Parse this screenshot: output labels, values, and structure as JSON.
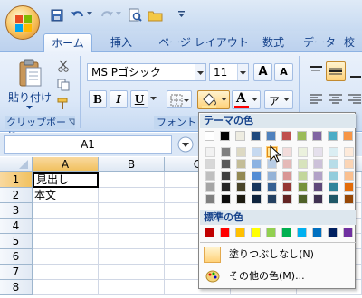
{
  "quick_access": {
    "save_icon": "save-icon",
    "undo_icon": "undo-icon",
    "redo_icon": "redo-icon",
    "print_preview_icon": "print-preview-icon",
    "open_icon": "open-folder-icon",
    "customize_icon": "customize-dropdown-icon"
  },
  "tabs": [
    {
      "label": "ホーム"
    },
    {
      "label": "挿入"
    },
    {
      "label": "ページ レイアウト"
    },
    {
      "label": "数式"
    },
    {
      "label": "データ"
    },
    {
      "label": "校"
    }
  ],
  "ribbon": {
    "clipboard": {
      "paste_label": "貼り付け",
      "group_label": "クリップボード"
    },
    "font": {
      "font_name": "MS Pゴシック",
      "font_size": "11",
      "group_label": "フォント",
      "bold": "B",
      "italic": "I",
      "underline": "U",
      "grow": "A",
      "shrink": "A",
      "font_color_letter": "A",
      "phonetic": "ア"
    }
  },
  "formula_bar": {
    "name_box": "A1"
  },
  "grid": {
    "columns": [
      "A",
      "B",
      "C"
    ],
    "rows": [
      "1",
      "2",
      "3",
      "4",
      "5",
      "6",
      "7",
      "8"
    ],
    "cells": {
      "A1": "見出し",
      "A2": "本文"
    }
  },
  "color_popup": {
    "theme_heading": "テーマの色",
    "standard_heading": "標準の色",
    "no_fill_label": "塗りつぶしなし(N)",
    "more_colors_label": "その他の色(M)...",
    "theme_colors": [
      "#ffffff",
      "#000000",
      "#eeece1",
      "#1f497d",
      "#4f81bd",
      "#c0504d",
      "#9bbb59",
      "#8064a2",
      "#4bacc6",
      "#f79646"
    ],
    "theme_shades": [
      [
        "#f2f2f2",
        "#d8d8d8",
        "#bfbfbf",
        "#a5a5a5",
        "#7f7f7f"
      ],
      [
        "#7f7f7f",
        "#595959",
        "#3f3f3f",
        "#262626",
        "#0c0c0c"
      ],
      [
        "#ddd9c3",
        "#c4bd97",
        "#938953",
        "#494429",
        "#1d1b10"
      ],
      [
        "#c6d9f0",
        "#8db3e2",
        "#548dd4",
        "#17365d",
        "#0f243e"
      ],
      [
        "#dbe5f1",
        "#b8cce4",
        "#95b3d7",
        "#366092",
        "#244061"
      ],
      [
        "#f2dcdb",
        "#e5b9b7",
        "#d99694",
        "#953734",
        "#632423"
      ],
      [
        "#ebf1dd",
        "#d7e3bc",
        "#c3d69b",
        "#76923c",
        "#4f6128"
      ],
      [
        "#e5e0ec",
        "#ccc1d9",
        "#b2a2c7",
        "#5f497a",
        "#3f3151"
      ],
      [
        "#dbeef3",
        "#b7dde8",
        "#92cddc",
        "#31859b",
        "#205867"
      ],
      [
        "#fdeada",
        "#fbd5b5",
        "#fac08f",
        "#e36c09",
        "#974806"
      ]
    ],
    "standard_colors": [
      "#c00000",
      "#ff0000",
      "#ffc000",
      "#ffff00",
      "#92d050",
      "#00b050",
      "#00b0f0",
      "#0070c0",
      "#002060",
      "#7030a0"
    ],
    "highlight_color": "#ffe699"
  }
}
